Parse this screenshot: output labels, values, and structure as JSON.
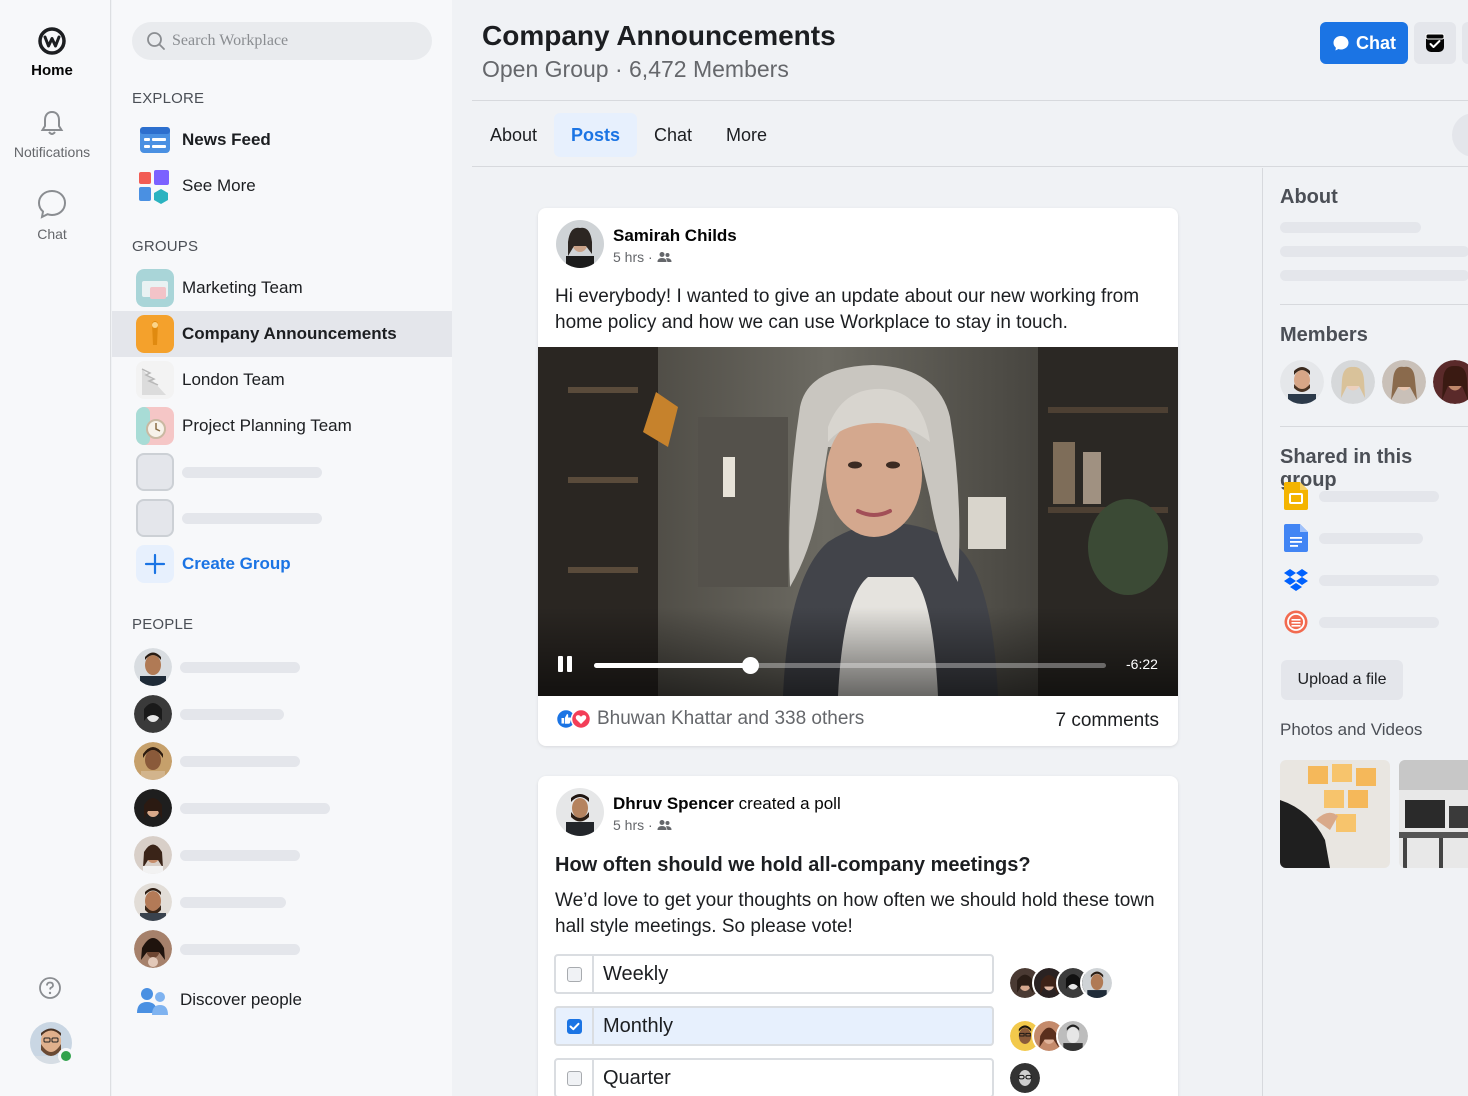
{
  "rail": {
    "home_label": "Home",
    "notifications_label": "Notifications",
    "chat_label": "Chat"
  },
  "nav": {
    "search_placeholder": "Search Workplace",
    "explore_heading": "EXPLORE",
    "explore_items": [
      {
        "label": "News Feed",
        "icon": "news-feed-icon"
      },
      {
        "label": "See More",
        "icon": "see-more-icon"
      }
    ],
    "groups_heading": "GROUPS",
    "groups": [
      {
        "label": "Marketing Team",
        "active": false
      },
      {
        "label": "Company Announcements",
        "active": true
      },
      {
        "label": "London Team",
        "active": false
      },
      {
        "label": "Project Planning Team",
        "active": false
      }
    ],
    "create_group_label": "Create Group",
    "people_heading": "PEOPLE",
    "discover_people_label": "Discover people"
  },
  "header": {
    "title": "Company Announcements",
    "subtitle": "Open Group · 6,472 Members",
    "chat_button_label": "Chat"
  },
  "tabs": [
    {
      "label": "About",
      "active": false
    },
    {
      "label": "Posts",
      "active": true
    },
    {
      "label": "Chat",
      "active": false
    },
    {
      "label": "More",
      "active": false
    }
  ],
  "posts": [
    {
      "author": "Samirah Childs",
      "time": "5 hrs · ",
      "text": "Hi everybody! I wanted to give an update about our new working from home policy and how we can use Workplace to stay in touch.",
      "video": {
        "time_remaining": "-6:22",
        "progress": 0.305
      },
      "reactions_text": "Bhuwan Khattar and 338 others",
      "comments_text": "7 comments"
    },
    {
      "author": "Dhruv Spencer",
      "action": " created a poll",
      "time": "5 hrs · ",
      "question": "How often should we hold all-company meetings?",
      "text": "We’d love to get your thoughts on how often we should hold these town hall style meetings. So please vote!",
      "options": [
        {
          "label": "Weekly",
          "checked": false
        },
        {
          "label": "Monthly",
          "checked": true
        },
        {
          "label": "Quarter",
          "checked": false
        }
      ]
    }
  ],
  "right": {
    "about_heading": "About",
    "members_heading": "Members",
    "shared_heading": "Shared in this group",
    "upload_label": "Upload a file",
    "photos_label": "Photos and Videos"
  },
  "colors": {
    "accent": "#1b74e4",
    "online": "#31a24c"
  }
}
